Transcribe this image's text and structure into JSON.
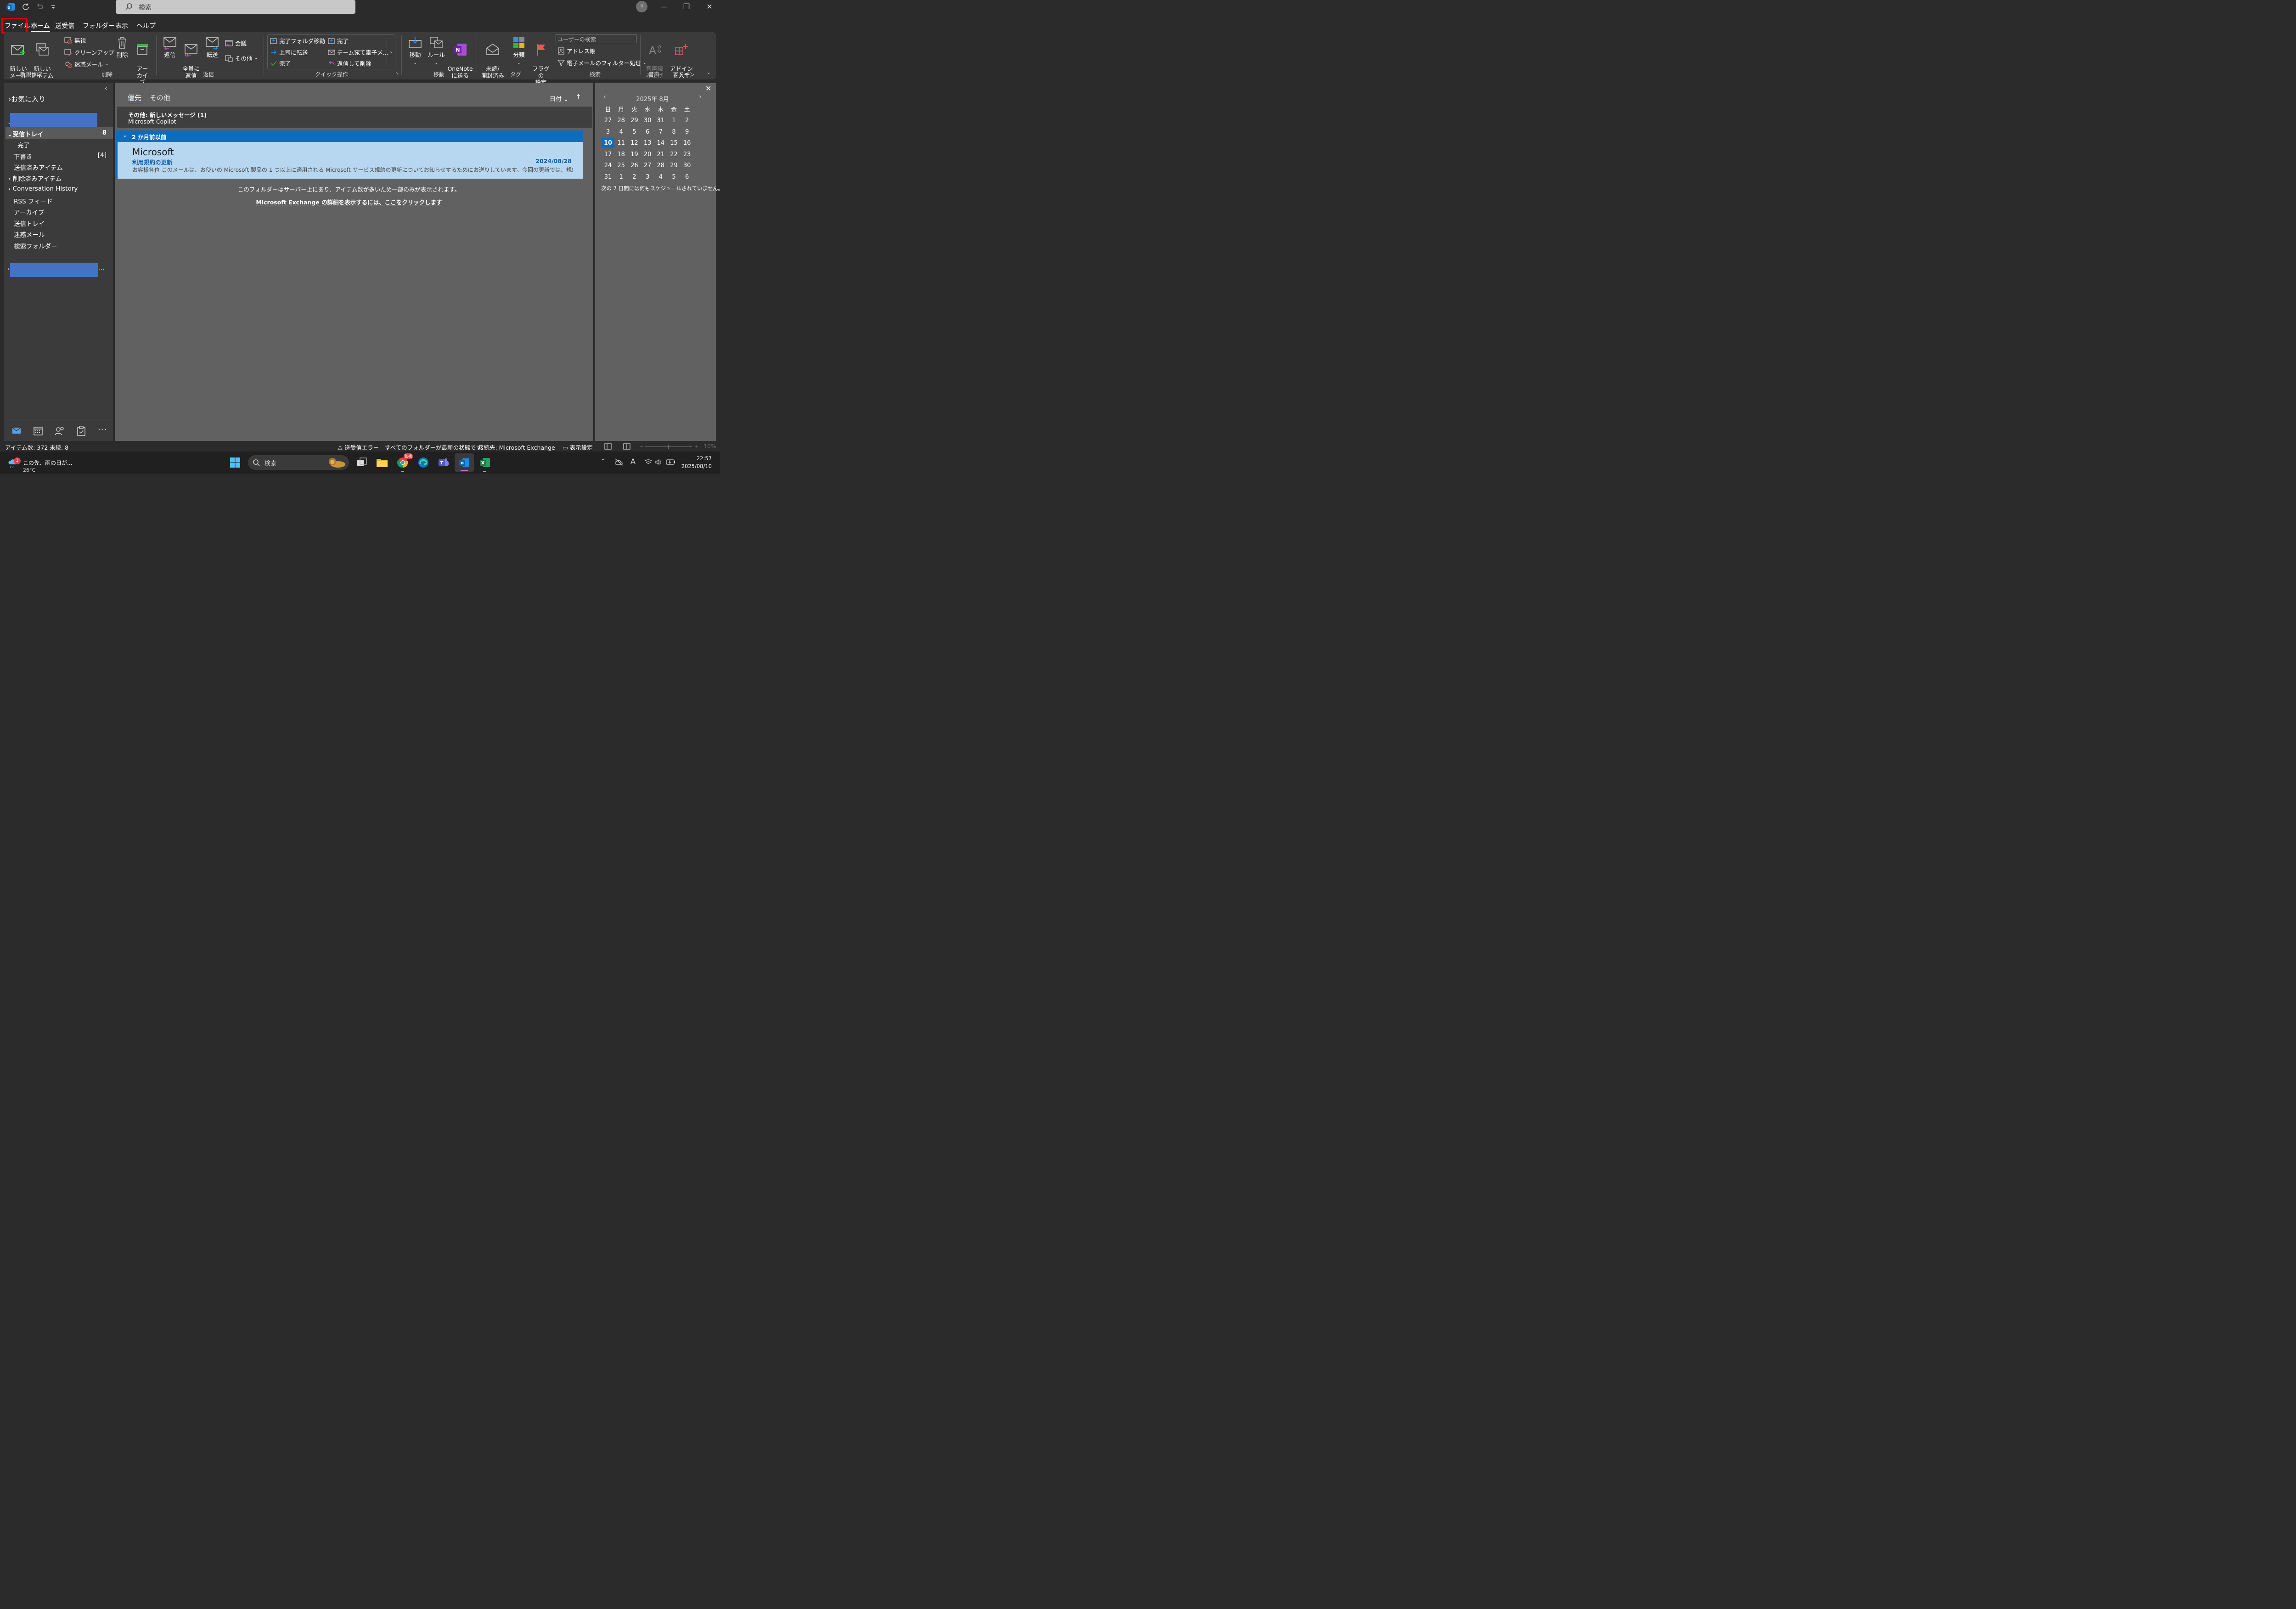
{
  "titlebar": {
    "search_placeholder": "検索",
    "account_initial": "II",
    "minimize": "—",
    "restore": "❐",
    "close": "✕"
  },
  "menu": {
    "tabs": [
      "ファイル",
      "ホーム",
      "送受信",
      "フォルダー",
      "表示",
      "ヘルプ"
    ],
    "active": "ホーム",
    "highlighted": "ファイル"
  },
  "ribbon": {
    "new_mail": "新しい\nメール",
    "new_items": "新しい\nアイテム",
    "ignore": "無視",
    "cleanup": "クリーンアップ",
    "junk": "迷惑メール",
    "delete": "削除",
    "archive": "アー\nカイブ",
    "reply": "返信",
    "reply_all": "全員に\n返信",
    "forward": "転送",
    "meeting": "会議",
    "more": "その他",
    "qs_move_done": "完了フォルダ移動",
    "qs_to_manager": "上司に転送",
    "qs_done": "完了",
    "qs_done2": "完了",
    "qs_team_mail": "チーム宛て電子メ...",
    "qs_reply_delete": "返信して削除",
    "move": "移動",
    "rules": "ルール",
    "onenote": "OneNote\nに送る",
    "unread_read": "未読/\n開封済み",
    "categorize": "分類",
    "flag": "フラグの\n設定",
    "search_people": "ユーザーの検索",
    "address_book": "アドレス帳",
    "filter_email": "電子メールのフィルター処理",
    "read_aloud": "音声読\nみ上げ",
    "get_addins": "アドイン\nを入手",
    "groups": {
      "new": "新規作成",
      "delete": "削除",
      "respond": "返信",
      "quick_steps": "クイック操作",
      "move": "移動",
      "tags": "タグ",
      "find": "検索",
      "speech": "音声",
      "addins": "アドイン"
    }
  },
  "folders": {
    "favorites": "お気に入り",
    "inbox": "受信トレイ",
    "inbox_count": "8",
    "done": "完了",
    "drafts": "下書き",
    "drafts_count": "[4]",
    "sent": "送信済みアイテム",
    "deleted": "削除済みアイテム",
    "conversation_history": "Conversation History",
    "rss": "RSS フィード",
    "archive": "アーカイブ",
    "outbox": "送信トレイ",
    "junk": "迷惑メール",
    "search_folders": "検索フォルダー",
    "ellipsis": "..."
  },
  "messages": {
    "tab_focused": "優先",
    "tab_other": "その他",
    "sort_label": "日付",
    "other_banner_title": "その他: 新しいメッセージ (1)",
    "other_banner_sender": "Microsoft Copilot",
    "group_header": "2 か月前以前",
    "items": [
      {
        "sender": "Microsoft",
        "subject": "利用規約の更新",
        "date": "2024/08/28",
        "preview": "お客様各位 このメールは、お使いの Microsoft 製品の 1 つ以上に適用される Microsoft サービス規約の更新についてお知らせするためにお送りしています。今回の更新では、規約を"
      }
    ],
    "server_notice": "このフォルダーはサーバー上にあり、アイテム数が多いため一部のみが表示されます。",
    "exchange_link": "Microsoft Exchange の詳細を表示するには、ここをクリックします"
  },
  "calendar": {
    "month_label": "2025年 8月",
    "weekdays": [
      "日",
      "月",
      "火",
      "水",
      "木",
      "金",
      "土"
    ],
    "weeks": [
      [
        "27",
        "28",
        "29",
        "30",
        "31",
        "1",
        "2"
      ],
      [
        "3",
        "4",
        "5",
        "6",
        "7",
        "8",
        "9"
      ],
      [
        "10",
        "11",
        "12",
        "13",
        "14",
        "15",
        "16"
      ],
      [
        "17",
        "18",
        "19",
        "20",
        "21",
        "22",
        "23"
      ],
      [
        "24",
        "25",
        "26",
        "27",
        "28",
        "29",
        "30"
      ],
      [
        "31",
        "1",
        "2",
        "3",
        "4",
        "5",
        "6"
      ]
    ],
    "today": "10",
    "no_schedule": "次の 7 日間には何もスケジュールされていません。"
  },
  "status": {
    "item_count": "アイテム数: 372",
    "unread": "未読: 8",
    "send_receive_error": "送受信エラー",
    "folders_up_to_date": "すべてのフォルダーが最新の状態です。",
    "connected": "接続先: Microsoft Exchange",
    "display_settings": "表示設定",
    "zoom": "10%"
  },
  "taskbar": {
    "weather_text": "この先、雨の日が...",
    "weather_temp": "26°C",
    "weather_badge": "3",
    "search": "検索",
    "chrome_badge": "監視",
    "time": "22:57",
    "date": "2025/08/10"
  },
  "colors": {
    "accent": "#0f6cbd",
    "selected_item": "#b7d7f0",
    "flag_red": "#e05a5a",
    "redaction": "#4472c4",
    "onenote": "#7719aa",
    "excel": "#1d7a45"
  }
}
